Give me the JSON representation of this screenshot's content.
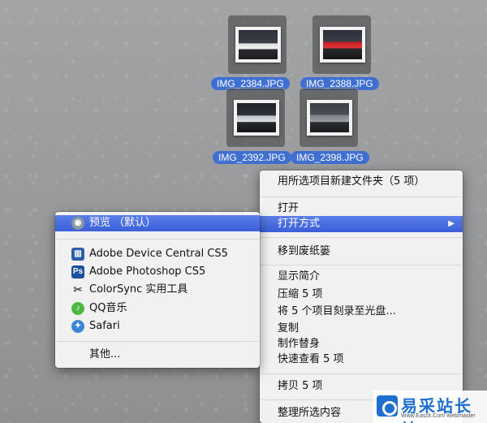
{
  "desktop_files": [
    {
      "name": "IMG_2384.JPG",
      "photo": "white"
    },
    {
      "name": "IMG_2388.JPG",
      "photo": "red"
    },
    {
      "name": "IMG_2392.JPG",
      "photo": "silver"
    },
    {
      "name": "IMG_2398.JPG",
      "photo": "grey"
    }
  ],
  "context_menu": {
    "new_folder": "用所选项目新建文件夹（5 项）",
    "open": "打开",
    "open_with": "打开方式",
    "move_to_trash": "移到废纸篓",
    "get_info": "显示简介",
    "compress": "压缩 5 项",
    "burn": "将 5 个项目刻录至光盘...",
    "duplicate": "复制",
    "make_alias": "制作替身",
    "quick_look": "快速查看 5 项",
    "copy": "拷贝 5 项",
    "clean_up": "整理所选内容"
  },
  "open_with_menu": {
    "preview": "预览 （默认）",
    "apps": [
      {
        "label": "Adobe Device Central CS5",
        "icon": "device-central-icon",
        "color": "#2d5fa8"
      },
      {
        "label": "Adobe Photoshop CS5",
        "icon": "photoshop-icon",
        "color": "#1c4f9c"
      },
      {
        "label": "ColorSync 实用工具",
        "icon": "colorsync-icon",
        "color": "#6b6b6b"
      },
      {
        "label": "QQ音乐",
        "icon": "qq-music-icon",
        "color": "#4fb845"
      },
      {
        "label": "Safari",
        "icon": "safari-icon",
        "color": "#3a86d6"
      }
    ],
    "other": "其他..."
  },
  "colors": {
    "highlight": "#3a5fd9",
    "filename_badge": "#3f6fd0"
  },
  "watermark": {
    "title": "易采站长站",
    "subtitle": "Www.Easck.Com  Webmaster"
  }
}
